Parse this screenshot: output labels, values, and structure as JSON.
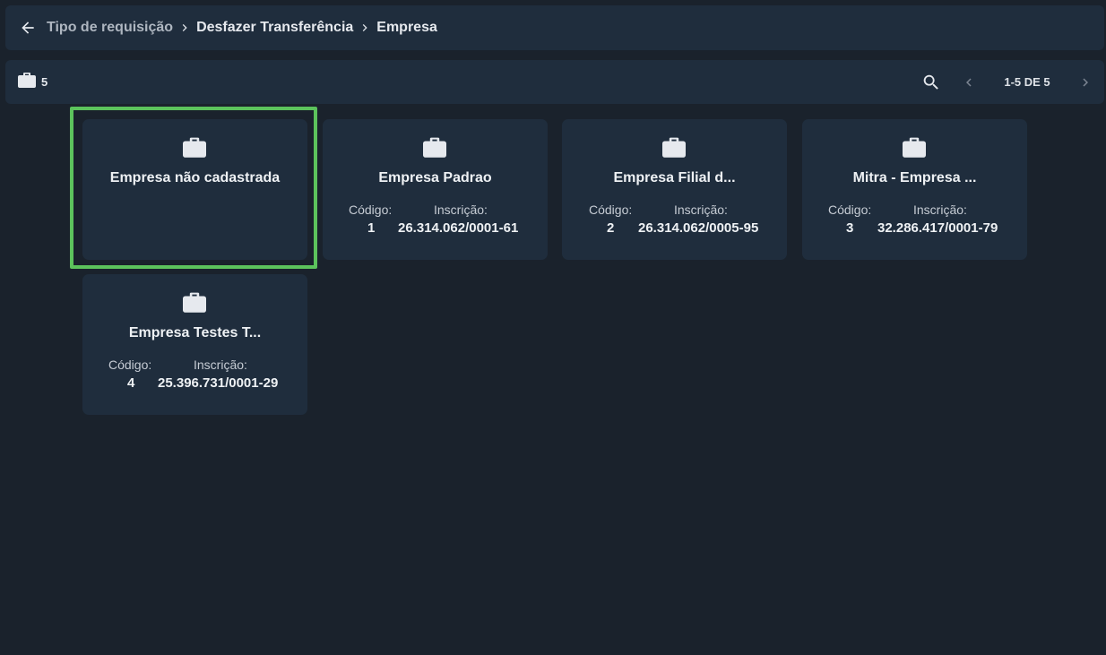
{
  "breadcrumb": {
    "items": [
      "Tipo de requisição",
      "Desfazer Transferência",
      "Empresa"
    ]
  },
  "toolbar": {
    "count": "5",
    "pagination": "1-5 DE 5"
  },
  "labels": {
    "codigo": "Código:",
    "inscricao": "Inscrição:"
  },
  "cards": [
    {
      "title": "Empresa não cadastrada",
      "codigo": "",
      "inscricao": ""
    },
    {
      "title": "Empresa Padrao",
      "codigo": "1",
      "inscricao": "26.314.062/0001-61"
    },
    {
      "title": "Empresa Filial d...",
      "codigo": "2",
      "inscricao": "26.314.062/0005-95"
    },
    {
      "title": "Mitra - Empresa ...",
      "codigo": "3",
      "inscricao": "32.286.417/0001-79"
    },
    {
      "title": "Empresa Testes T...",
      "codigo": "4",
      "inscricao": "25.396.731/0001-29"
    }
  ],
  "colors": {
    "background": "#1a222c",
    "panel": "#1f2d3d",
    "selection": "#5cc35c"
  },
  "icons": [
    "back-arrow-icon",
    "chevron-right-icon",
    "briefcase-icon",
    "search-icon",
    "chevron-left-icon"
  ]
}
